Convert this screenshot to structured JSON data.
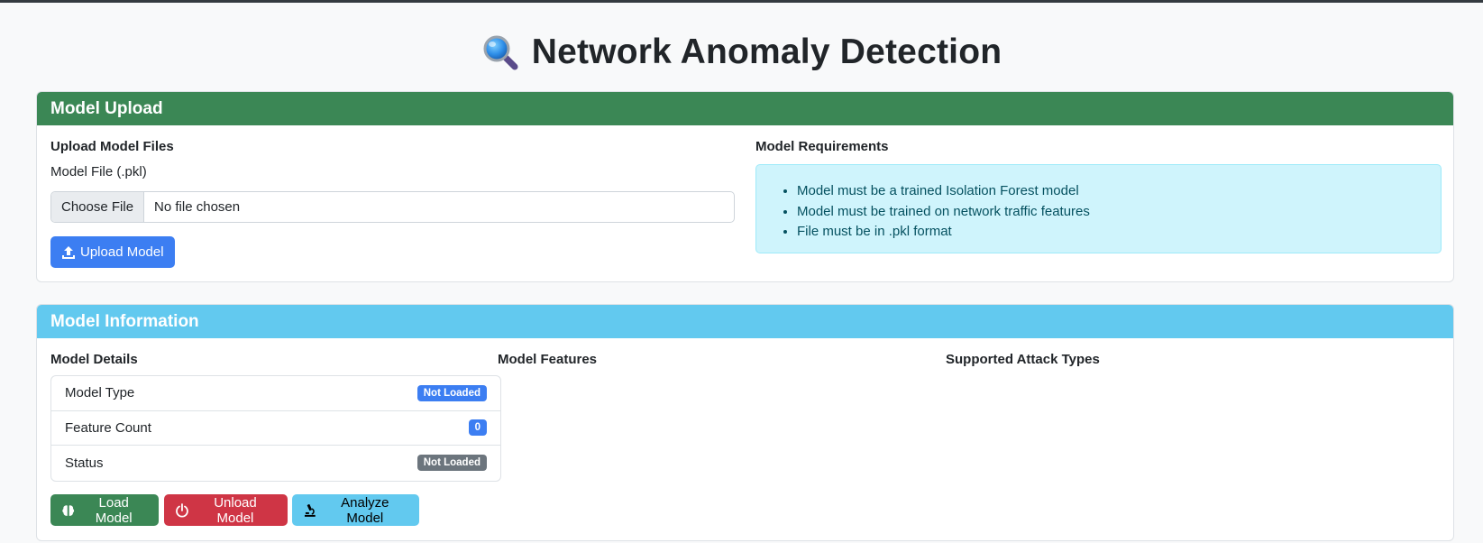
{
  "page": {
    "title": "Network Anomaly Detection",
    "title_icon": "magnifier-icon"
  },
  "upload_card": {
    "header": "Model Upload",
    "header_color": "#3b8755",
    "upload_heading": "Upload Model Files",
    "file_label": "Model File (.pkl)",
    "choose_file_label": "Choose File",
    "file_status": "No file chosen",
    "upload_button_label": "Upload Model",
    "upload_button_icon": "upload-icon",
    "requirements_heading": "Model Requirements",
    "requirements": [
      "Model must be a trained Isolation Forest model",
      "Model must be trained on network traffic features",
      "File must be in .pkl format"
    ]
  },
  "info_card": {
    "header": "Model Information",
    "header_color": "#62c9ef",
    "details_heading": "Model Details",
    "features_heading": "Model Features",
    "attack_types_heading": "Supported Attack Types",
    "details": [
      {
        "label": "Model Type",
        "badge": "Not Loaded",
        "badge_color": "#3c7ef2"
      },
      {
        "label": "Feature Count",
        "badge": "0",
        "badge_color": "#3c7ef2"
      },
      {
        "label": "Status",
        "badge": "Not Loaded",
        "badge_color": "#6c757d"
      }
    ],
    "buttons": {
      "load_label": "Load Model",
      "load_icon": "brain-icon",
      "unload_label": "Unload Model",
      "unload_icon": "power-icon",
      "analyze_label": "Analyze Model",
      "analyze_icon": "microscope-icon"
    }
  }
}
